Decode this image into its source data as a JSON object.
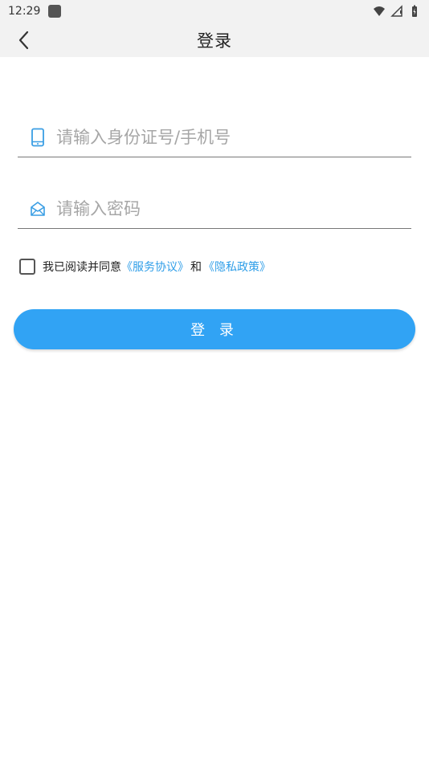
{
  "status_bar": {
    "time": "12:29"
  },
  "app_bar": {
    "title": "登录"
  },
  "form": {
    "phone_placeholder": "请输入身份证号/手机号",
    "password_placeholder": "请输入密码",
    "agree_text": "我已阅读并同意",
    "service_link": "《服务协议》",
    "and_text": "和",
    "privacy_link": "《隐私政策》",
    "login_label": "登 录"
  },
  "colors": {
    "accent": "#31a3f4",
    "link": "#2f9ee8",
    "icon": "#3a9ee4"
  }
}
